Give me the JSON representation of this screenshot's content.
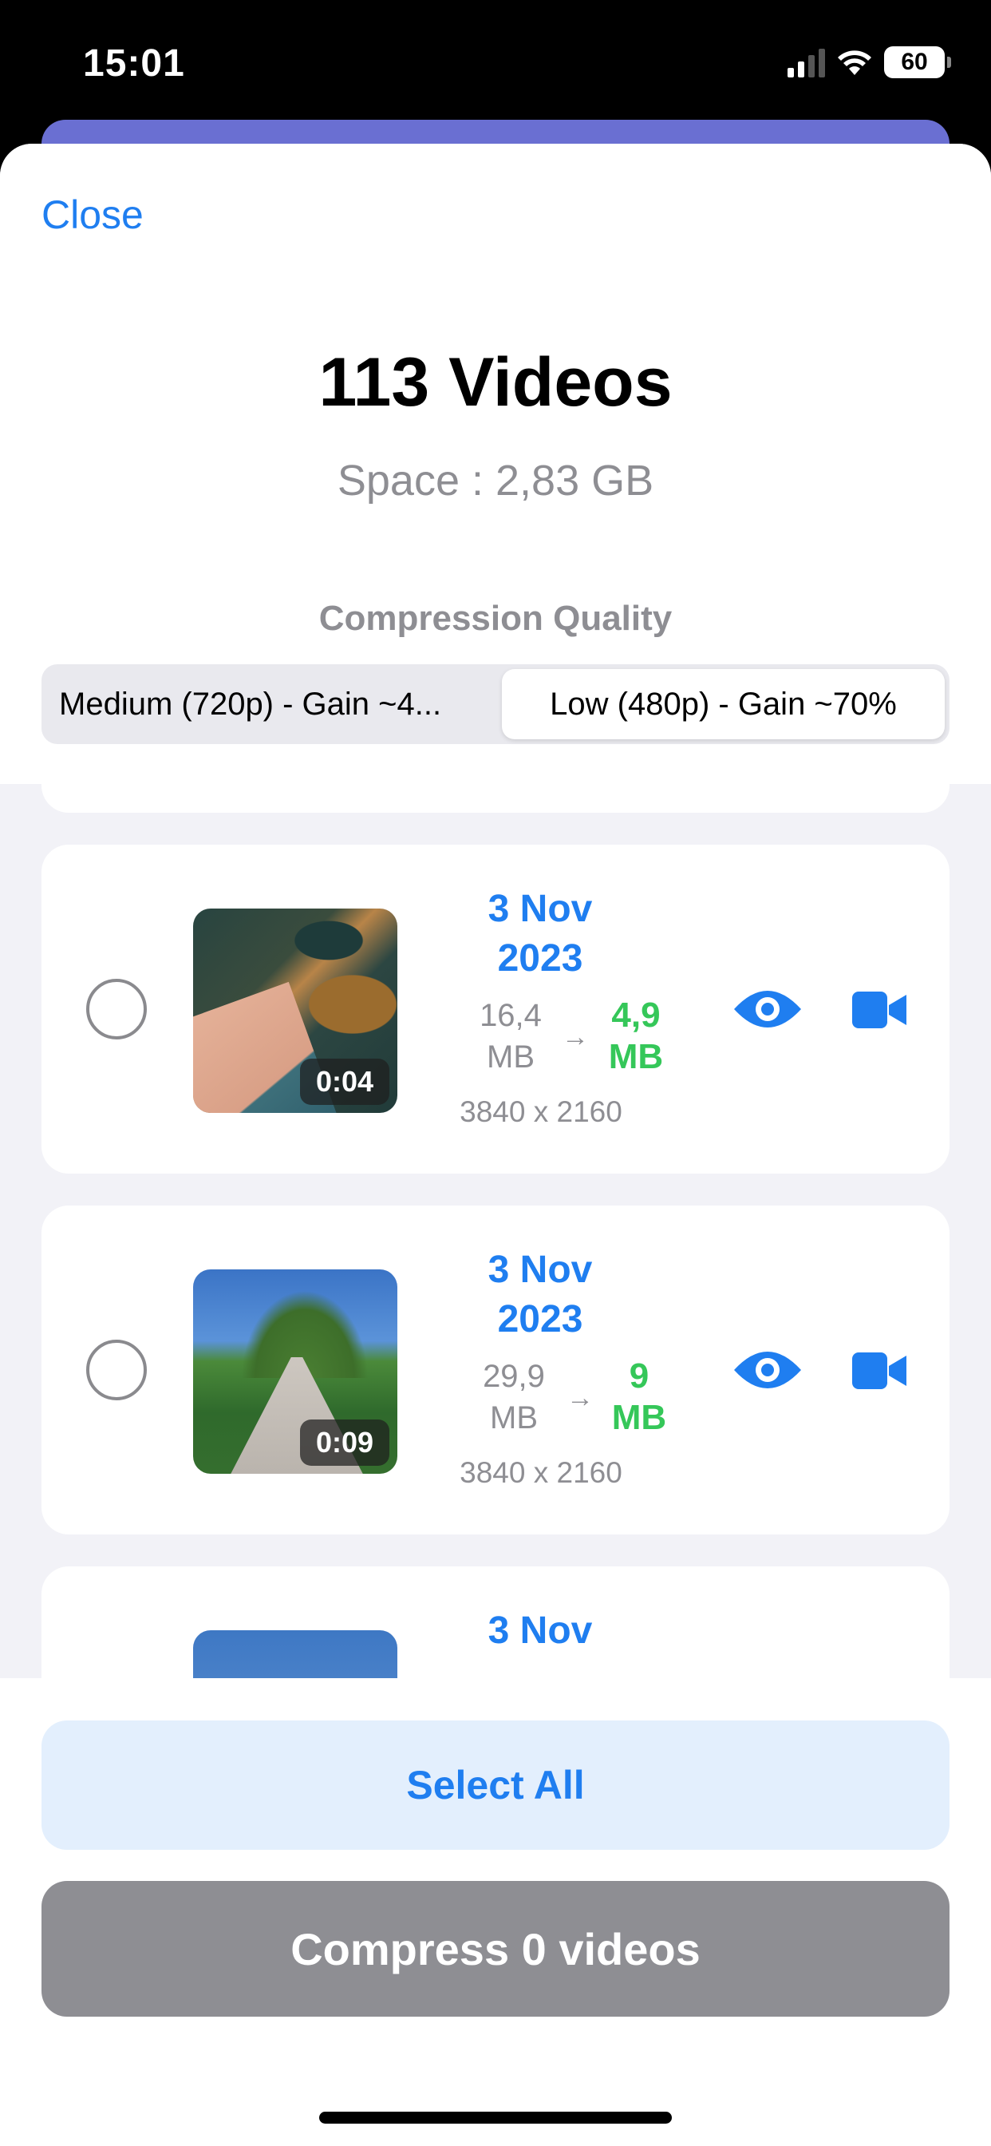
{
  "status_bar": {
    "time": "15:01",
    "battery": "60",
    "icons": [
      "signal-icon",
      "wifi-icon",
      "battery-icon"
    ]
  },
  "header": {
    "close_label": "Close",
    "title": "113 Videos",
    "space": "Space : 2,83 GB",
    "compression_label": "Compression Quality",
    "segments": [
      {
        "label": "Medium (720p) - Gain ~4...",
        "selected": false
      },
      {
        "label": "Low (480p) - Gain ~70%",
        "selected": true
      }
    ]
  },
  "videos": [
    {
      "duration": "0:04",
      "date_line1": "3 Nov",
      "date_line2": "2023",
      "old_size_line1": "16,4",
      "old_size_line2": "MB",
      "arrow": "→",
      "new_size_line1": "4,9",
      "new_size_line2": "MB",
      "resolution": "3840 x 2160",
      "selected": false
    },
    {
      "duration": "0:09",
      "date_line1": "3 Nov",
      "date_line2": "2023",
      "old_size_line1": "29,9",
      "old_size_line2": "MB",
      "arrow": "→",
      "new_size_line1": "9",
      "new_size_line2": "MB",
      "resolution": "3840 x 2160",
      "selected": false
    },
    {
      "date_line1": "3 Nov"
    }
  ],
  "footer": {
    "select_all_label": "Select All",
    "compress_label": "Compress 0 videos"
  },
  "colors": {
    "accent": "#1f7ef0",
    "gain": "#35c759",
    "muted": "#8e8e93",
    "compress_disabled": "#8e8e93",
    "select_all_bg": "#e3effd"
  }
}
